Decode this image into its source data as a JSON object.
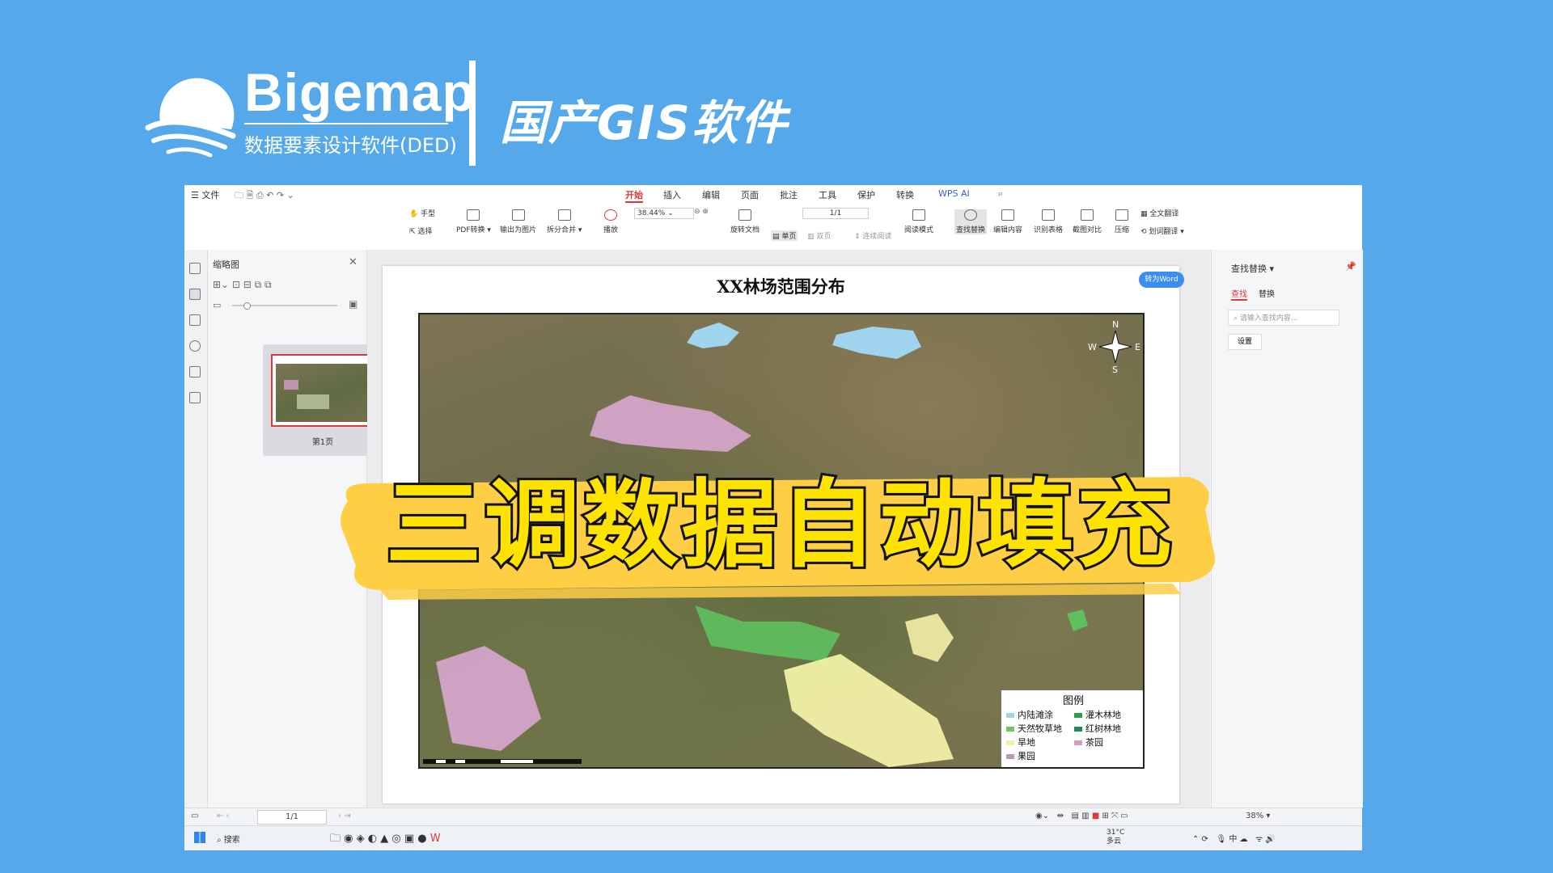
{
  "brand": {
    "name": "Bigemap",
    "subtitle": "数据要素设计软件(DED)",
    "slogan": "国产GIS软件"
  },
  "banner": {
    "text": "三调数据自动填充"
  },
  "menubar": {
    "file": "☰ 文件",
    "tabs": [
      "开始",
      "插入",
      "编辑",
      "页面",
      "批注",
      "工具",
      "保护",
      "转换"
    ],
    "active_tab": "开始",
    "wps_ai": "WPS AI"
  },
  "toolbar": {
    "hand": "手型",
    "select": "选择",
    "pdf_convert": "PDF转换 ▾",
    "export_image": "输出为图片",
    "split_merge": "拆分合并 ▾",
    "play": "播放",
    "zoom": "38.44%",
    "rotate": "旋转文档",
    "single": "单页",
    "double": "双页",
    "continuous": "连续阅读",
    "page": "1/1",
    "read_mode": "阅读模式",
    "find_replace": "查找替换",
    "edit_content": "编辑内容",
    "recognize_table": "识别表格",
    "compare": "截图对比",
    "compress": "压缩",
    "translate_all": "全文翻译",
    "translate_word": "划词翻译 ▾"
  },
  "thumbnails": {
    "title": "缩略图",
    "page_label": "第1页"
  },
  "document": {
    "title": "XX林场范围分布",
    "to_word": "转为Word",
    "compass": {
      "n": "N",
      "s": "S",
      "e": "E",
      "w": "W"
    },
    "legend": {
      "title": "图例",
      "items": [
        {
          "label": "内陆滩涂",
          "color": "#9fd3ee"
        },
        {
          "label": "灌木林地",
          "color": "#2f9e4a"
        },
        {
          "label": "天然牧草地",
          "color": "#6cc46a"
        },
        {
          "label": "红树林地",
          "color": "#1f8a55"
        },
        {
          "label": "旱地",
          "color": "#f2f0a6"
        },
        {
          "label": "茶园",
          "color": "#d29ec0"
        },
        {
          "label": "果园",
          "color": "#b79ab8"
        }
      ]
    }
  },
  "rightpanel": {
    "title": "查找替换 ▾",
    "tab_find": "查找",
    "tab_replace": "替换",
    "search_placeholder": "请输入查找内容...",
    "settings": "设置"
  },
  "statusbar": {
    "page": "1/1",
    "zoom": "38% ▾"
  },
  "taskbar": {
    "search": "搜索",
    "weather_temp": "31°C",
    "weather_desc": "多云",
    "ime": "中"
  }
}
